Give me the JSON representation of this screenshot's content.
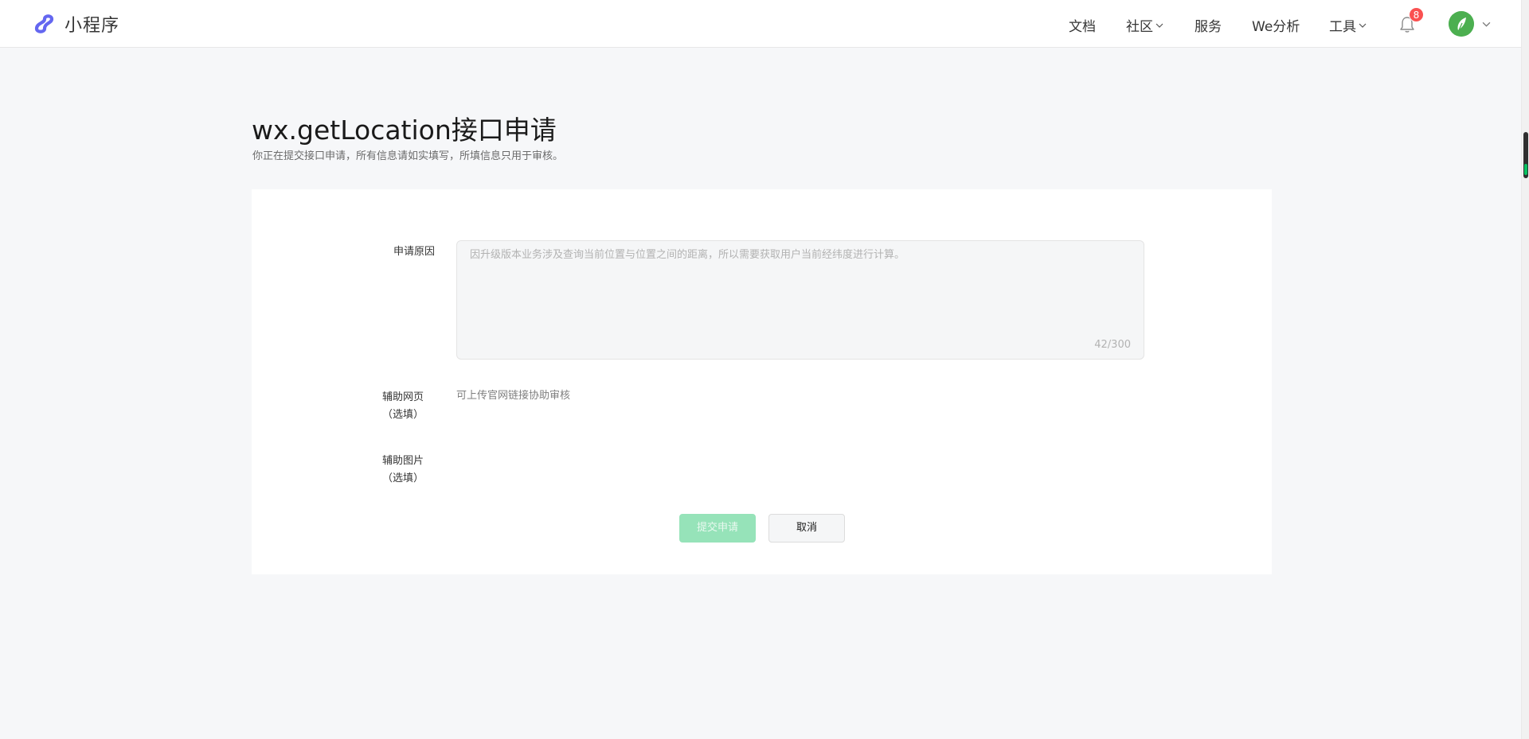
{
  "app": {
    "brand_name": "小程序",
    "brand_color": "#6467f0"
  },
  "nav": {
    "items": [
      {
        "label": "文档",
        "dropdown": false
      },
      {
        "label": "社区",
        "dropdown": true
      },
      {
        "label": "服务",
        "dropdown": false
      },
      {
        "label": "We分析",
        "dropdown": false
      },
      {
        "label": "工具",
        "dropdown": true
      }
    ],
    "notifications": {
      "count": "8",
      "icon": "bell-icon"
    },
    "avatar": {
      "icon": "avatar",
      "color": "#4caf50"
    }
  },
  "page": {
    "title": "wx.getLocation接口申请",
    "subtitle": "你正在提交接口申请，所有信息请如实填写，所填信息只用于审核。"
  },
  "form": {
    "reason_label": "申请原因",
    "reason_placeholder": "因升级版本业务涉及查询当前位置与位置之间的距离，所以需要获取用户当前经纬度进行计算。",
    "reason_counter": "42/300",
    "web_label_line1": "辅助网页",
    "web_label_line2": "（选填）",
    "web_hint": "可上传官网链接协助审核",
    "img_label_line1": "辅助图片",
    "img_label_line2": "（选填）",
    "submit_label": "提交申请",
    "cancel_label": "取消",
    "submit_color": "#96e3b9"
  }
}
